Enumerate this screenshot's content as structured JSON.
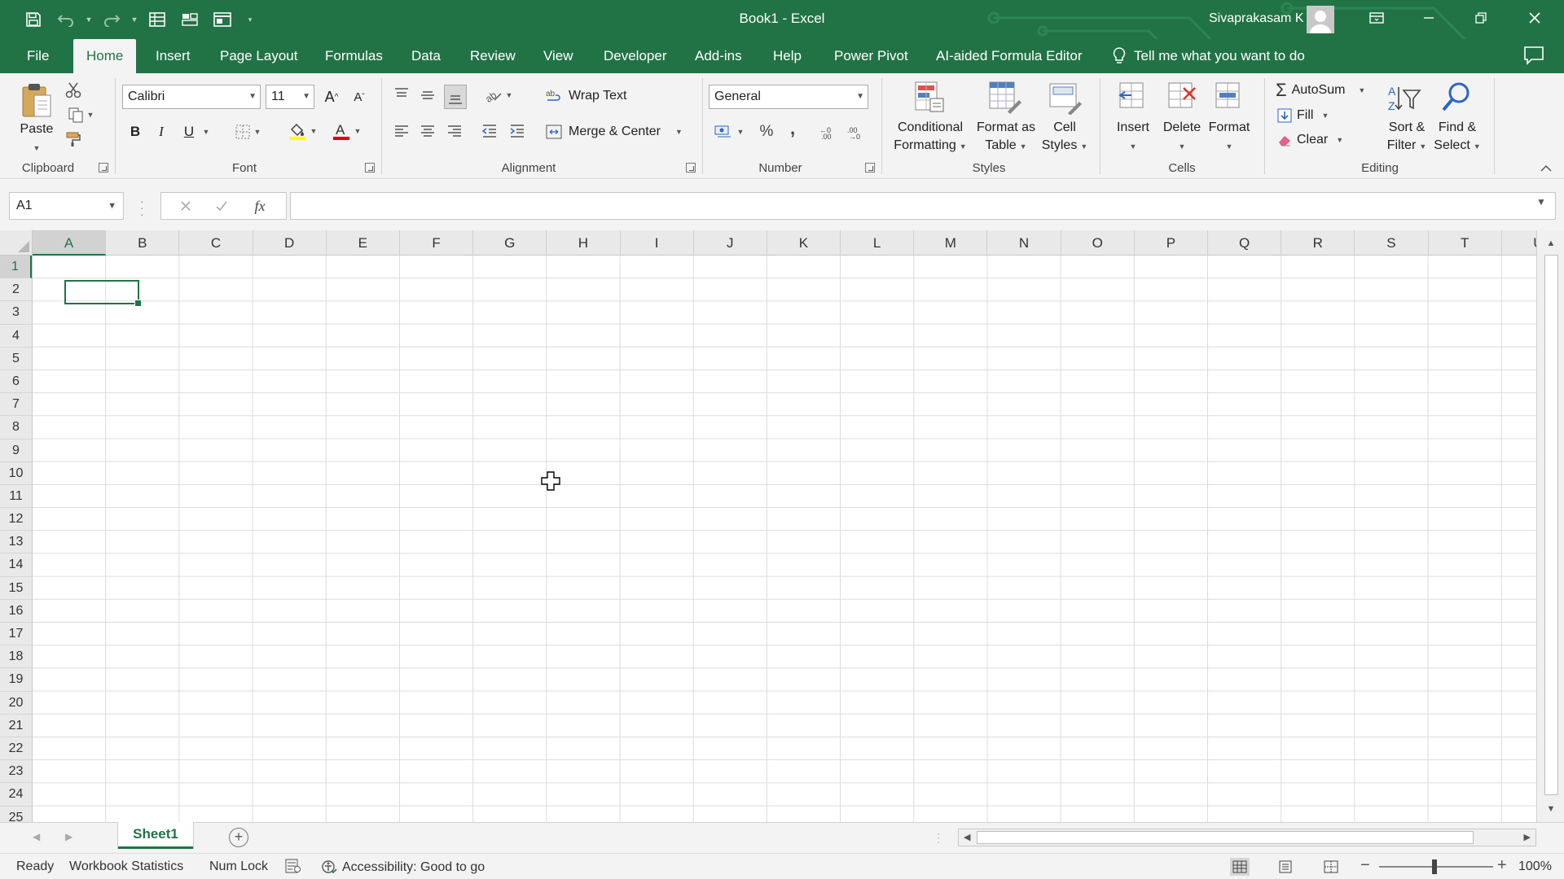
{
  "app": {
    "title": "Book1  -  Excel",
    "user_name": "Sivaprakasam K"
  },
  "tabs": [
    {
      "label": "File",
      "active": false
    },
    {
      "label": "Home",
      "active": true
    },
    {
      "label": "Insert",
      "active": false
    },
    {
      "label": "Page Layout",
      "active": false
    },
    {
      "label": "Formulas",
      "active": false
    },
    {
      "label": "Data",
      "active": false
    },
    {
      "label": "Review",
      "active": false
    },
    {
      "label": "View",
      "active": false
    },
    {
      "label": "Developer",
      "active": false
    },
    {
      "label": "Add-ins",
      "active": false
    },
    {
      "label": "Help",
      "active": false
    },
    {
      "label": "Power Pivot",
      "active": false
    },
    {
      "label": "AI-aided Formula Editor",
      "active": false
    }
  ],
  "tell_me": "Tell me what you want to do",
  "ribbon": {
    "clipboard": {
      "label": "Clipboard",
      "paste": "Paste"
    },
    "font": {
      "label": "Font",
      "name": "Calibri",
      "size": "11",
      "bold": "B",
      "italic": "I",
      "underline": "U"
    },
    "alignment": {
      "label": "Alignment",
      "wrap_text": "Wrap Text",
      "merge_center": "Merge & Center"
    },
    "number": {
      "label": "Number",
      "format": "General",
      "percent": "%",
      "comma": ","
    },
    "styles": {
      "label": "Styles",
      "conditional_1": "Conditional",
      "conditional_2": "Formatting",
      "format_table_1": "Format as",
      "format_table_2": "Table",
      "cell_styles_1": "Cell",
      "cell_styles_2": "Styles"
    },
    "cells": {
      "label": "Cells",
      "insert": "Insert",
      "delete": "Delete",
      "format": "Format"
    },
    "editing": {
      "label": "Editing",
      "autosum": "AutoSum",
      "fill": "Fill",
      "clear": "Clear",
      "sort_1": "Sort &",
      "sort_2": "Filter",
      "find_1": "Find &",
      "find_2": "Select"
    }
  },
  "formula_bar": {
    "name_box": "A1",
    "fx": "fx",
    "value": ""
  },
  "grid": {
    "columns": [
      "A",
      "B",
      "C",
      "D",
      "E",
      "F",
      "G",
      "H",
      "I",
      "J",
      "K",
      "L",
      "M",
      "N",
      "O",
      "P",
      "Q",
      "R",
      "S",
      "T",
      "U"
    ],
    "rows": [
      "1",
      "2",
      "3",
      "4",
      "5",
      "6",
      "7",
      "8",
      "9",
      "10",
      "11",
      "12",
      "13",
      "14",
      "15",
      "16",
      "17",
      "18",
      "19",
      "20",
      "21",
      "22",
      "23",
      "24",
      "25"
    ],
    "active_cell": "A1"
  },
  "sheets": [
    {
      "name": "Sheet1",
      "active": true
    }
  ],
  "status": {
    "mode": "Ready",
    "workbook_stats": "Workbook Statistics",
    "num_lock": "Num Lock",
    "accessibility": "Accessibility: Good to go",
    "zoom": "100%"
  },
  "colors": {
    "accent": "#217346",
    "ribbon_bg": "#f3f3f3"
  },
  "icons": [
    "save-icon",
    "undo-icon",
    "redo-icon",
    "form-icon",
    "new-icon",
    "layout-icon",
    "customize-icon",
    "lightbulb-icon",
    "comments-icon",
    "paste-icon",
    "cut-icon",
    "copy-icon",
    "format-painter-icon",
    "sum-icon",
    "fill-icon",
    "eraser-icon",
    "sort-icon",
    "find-icon",
    "cursor-icon"
  ]
}
